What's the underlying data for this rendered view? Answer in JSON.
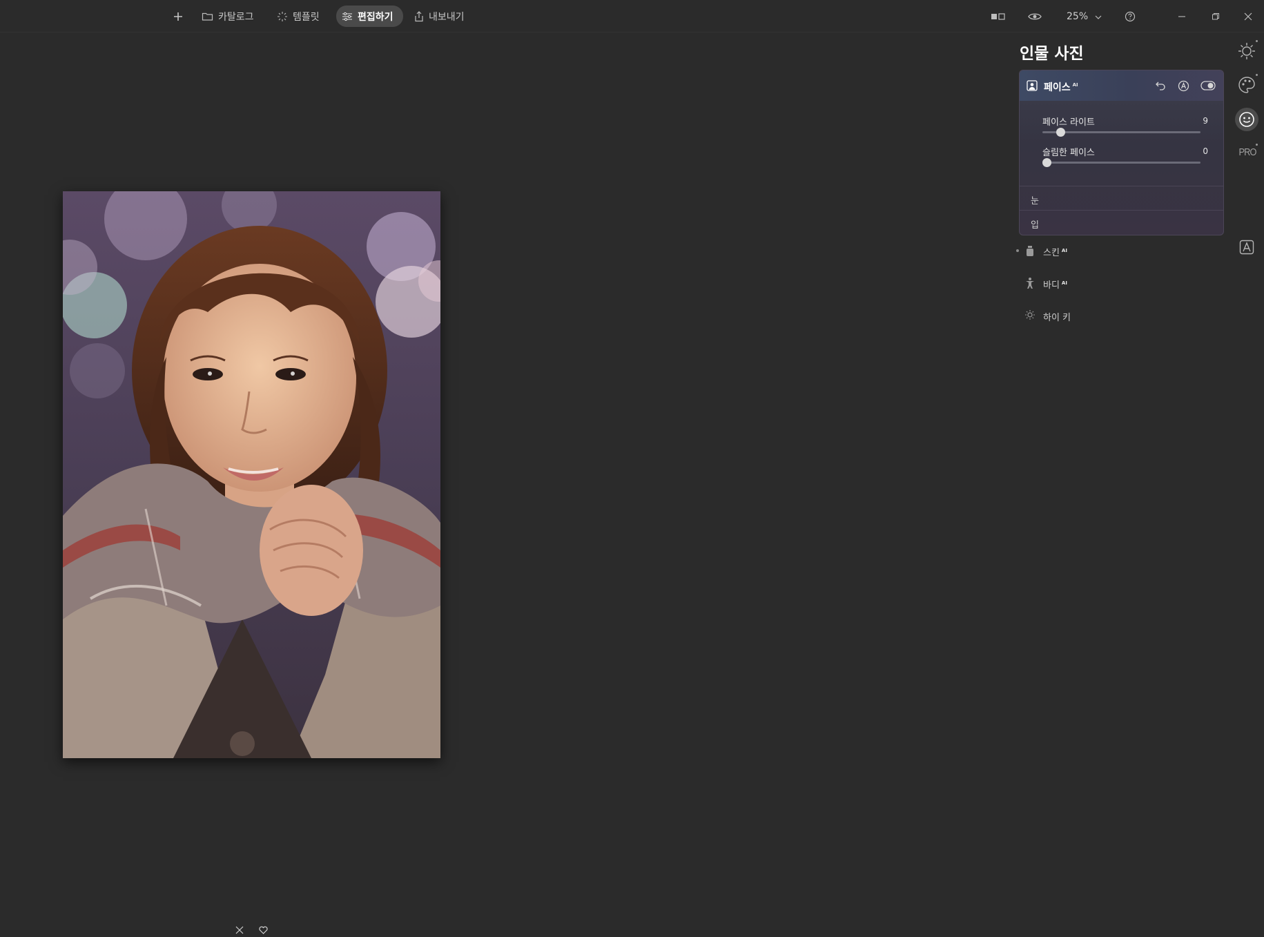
{
  "toolbar": {
    "add_label": "+",
    "catalog_label": "카탈로그",
    "templates_label": "템플릿",
    "edit_label": "편집하기",
    "export_label": "내보내기",
    "zoom_value": "25%"
  },
  "panel": {
    "title": "인물 사진",
    "face": {
      "title": "페이스",
      "ai_badge": "AI",
      "sliders": [
        {
          "label": "페이스 라이트",
          "value": "9",
          "fraction": 0.09
        },
        {
          "label": "슬림한 페이스",
          "value": "0",
          "fraction": 0.0
        }
      ],
      "sub_sections": [
        "눈",
        "입"
      ]
    },
    "tools": [
      {
        "label": "스킨",
        "ai": "AI",
        "icon": "skin-bottle-icon"
      },
      {
        "label": "바디",
        "ai": "AI",
        "icon": "body-figure-icon"
      },
      {
        "label": "하이 키",
        "ai": "",
        "icon": "high-key-sun-icon"
      }
    ]
  },
  "rail": {
    "pro_label": "PRO"
  },
  "colors": {
    "background": "#2b2b2b",
    "active_tab": "#4a4a4a",
    "face_card_top": "#3e4a64",
    "face_card_bottom": "#3a3343"
  }
}
